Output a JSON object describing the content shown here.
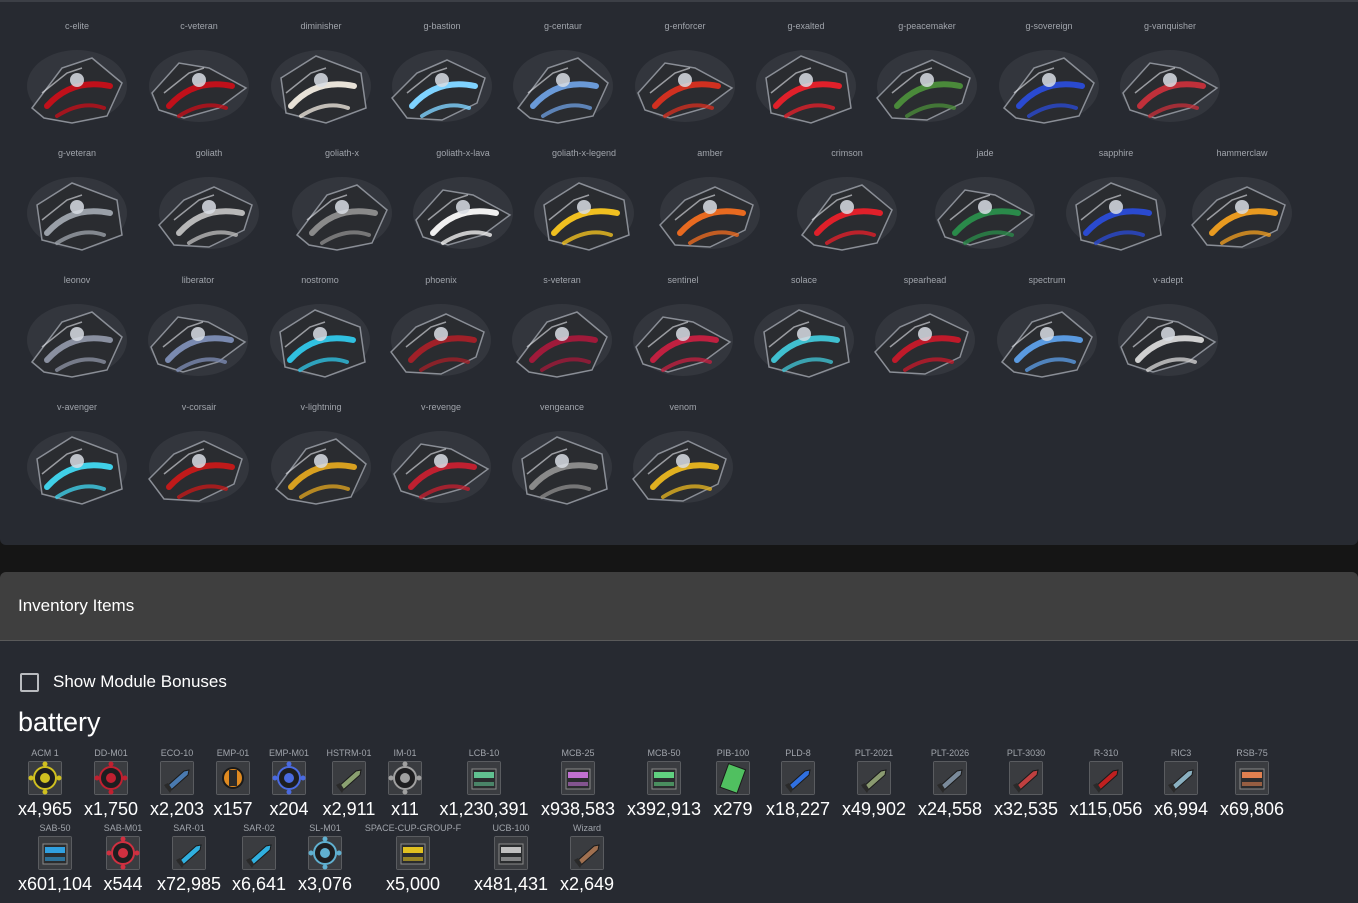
{
  "ships": {
    "rows": [
      [
        {
          "name": "c-elite",
          "color": "#c0101a"
        },
        {
          "name": "c-veteran",
          "color": "#c0101a"
        },
        {
          "name": "diminisher",
          "color": "#e8e2d8"
        },
        {
          "name": "g-bastion",
          "color": "#7fd3ff"
        },
        {
          "name": "g-centaur",
          "color": "#6a9ad8"
        },
        {
          "name": "g-enforcer",
          "color": "#d03020"
        },
        {
          "name": "g-exalted",
          "color": "#e0202a"
        },
        {
          "name": "g-peacemaker",
          "color": "#4a8a3a"
        },
        {
          "name": "g-sovereign",
          "color": "#2a4ad0"
        },
        {
          "name": "g-vanquisher",
          "color": "#c0303a"
        }
      ],
      [
        {
          "name": "g-veteran",
          "color": "#9aa0a8"
        },
        {
          "name": "goliath",
          "color": "#b8b8b8"
        },
        {
          "name": "goliath-x",
          "color": "#8a8a8a"
        },
        {
          "name": "goliath-x-lava",
          "color": "#f0f0f0"
        },
        {
          "name": "goliath-x-legend",
          "color": "#f0c020"
        },
        {
          "name": "amber",
          "color": "#e86a20"
        },
        {
          "name": "crimson",
          "color": "#e0202a"
        },
        {
          "name": "jade",
          "color": "#2a8a4a"
        },
        {
          "name": "sapphire",
          "color": "#2a4ad0"
        },
        {
          "name": "hammerclaw",
          "color": "#e89a20"
        }
      ],
      [
        {
          "name": "leonov",
          "color": "#8a90a0"
        },
        {
          "name": "liberator",
          "color": "#7a8ab0"
        },
        {
          "name": "nostromo",
          "color": "#30c0e0"
        },
        {
          "name": "phoenix",
          "color": "#a02028"
        },
        {
          "name": "s-veteran",
          "color": "#a01a3a"
        },
        {
          "name": "sentinel",
          "color": "#c02040"
        },
        {
          "name": "solace",
          "color": "#40c0d0"
        },
        {
          "name": "spearhead",
          "color": "#c01a2a"
        },
        {
          "name": "spectrum",
          "color": "#5a9ae0"
        },
        {
          "name": "v-adept",
          "color": "#d0d0d0"
        }
      ],
      [
        {
          "name": "v-avenger",
          "color": "#40d0e8"
        },
        {
          "name": "v-corsair",
          "color": "#c01a1a"
        },
        {
          "name": "v-lightning",
          "color": "#d8a020"
        },
        {
          "name": "v-revenge",
          "color": "#c02030"
        },
        {
          "name": "vengeance",
          "color": "#8a8a8a"
        },
        {
          "name": "venom",
          "color": "#e0b020"
        }
      ]
    ]
  },
  "inventory": {
    "title": "Inventory Items",
    "show_module_bonuses_label": "Show Module Bonuses",
    "section_title": "battery",
    "rows": [
      [
        {
          "name": "ACM 1",
          "count": "x4,965",
          "color": "#d0c020",
          "icon": "mine-icon"
        },
        {
          "name": "DD-M01",
          "count": "x1,750",
          "color": "#c02030",
          "icon": "mine-icon"
        },
        {
          "name": "ECO-10",
          "count": "x2,203",
          "color": "#4a7ab0",
          "icon": "rocket-icon"
        },
        {
          "name": "EMP-01",
          "count": "x157",
          "color": "#e08a20",
          "icon": "emp-icon"
        },
        {
          "name": "EMP-M01",
          "count": "x204",
          "color": "#4a6ae0",
          "icon": "mine-icon"
        },
        {
          "name": "HSTRM-01",
          "count": "x2,911",
          "color": "#8aa070",
          "icon": "rocket-icon"
        },
        {
          "name": "IM-01",
          "count": "x11",
          "color": "#a0a0a0",
          "icon": "mine-icon"
        },
        {
          "name": "LCB-10",
          "count": "x1,230,391",
          "color": "#60c090",
          "icon": "ammo-box-icon"
        },
        {
          "name": "MCB-25",
          "count": "x938,583",
          "color": "#c070d0",
          "icon": "ammo-box-icon"
        },
        {
          "name": "MCB-50",
          "count": "x392,913",
          "color": "#60d080",
          "icon": "ammo-box-icon"
        },
        {
          "name": "PIB-100",
          "count": "x279",
          "color": "#50c060",
          "icon": "battery-icon"
        },
        {
          "name": "PLD-8",
          "count": "x18,227",
          "color": "#3070e0",
          "icon": "rocket-icon"
        },
        {
          "name": "PLT-2021",
          "count": "x49,902",
          "color": "#8a9a70",
          "icon": "rocket-icon"
        },
        {
          "name": "PLT-2026",
          "count": "x24,558",
          "color": "#7a8a9a",
          "icon": "rocket-icon"
        },
        {
          "name": "PLT-3030",
          "count": "x32,535",
          "color": "#c04040",
          "icon": "rocket-icon"
        },
        {
          "name": "R-310",
          "count": "x115,056",
          "color": "#c02020",
          "icon": "rocket-icon"
        },
        {
          "name": "RIC3",
          "count": "x6,994",
          "color": "#8ab0c0",
          "icon": "rocket-icon"
        },
        {
          "name": "RSB-75",
          "count": "x69,806",
          "color": "#e08050",
          "icon": "ammo-box-icon"
        }
      ],
      [
        {
          "name": "SAB-50",
          "count": "x601,104",
          "color": "#30a0e0",
          "icon": "ammo-box-icon"
        },
        {
          "name": "SAB-M01",
          "count": "x544",
          "color": "#d03040",
          "icon": "mine-icon"
        },
        {
          "name": "SAR-01",
          "count": "x72,985",
          "color": "#30b0e0",
          "icon": "rocket-icon"
        },
        {
          "name": "SAR-02",
          "count": "x6,641",
          "color": "#30b0e0",
          "icon": "rocket-icon"
        },
        {
          "name": "SL-M01",
          "count": "x3,076",
          "color": "#60b0d0",
          "icon": "mine-icon"
        },
        {
          "name": "SPACE-CUP-GROUP-F",
          "count": "x5,000",
          "color": "#e0c020",
          "icon": "ammo-box-icon"
        },
        {
          "name": "UCB-100",
          "count": "x481,431",
          "color": "#c0c0c0",
          "icon": "ammo-box-icon"
        },
        {
          "name": "Wizard",
          "count": "x2,649",
          "color": "#a07050",
          "icon": "rocket-icon"
        }
      ]
    ]
  }
}
